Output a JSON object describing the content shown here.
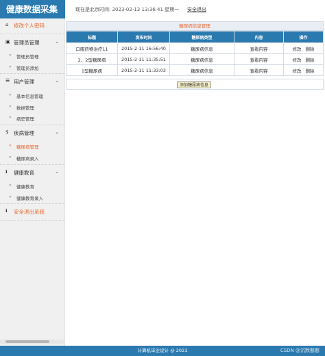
{
  "app": {
    "title": "健康数据采集"
  },
  "header": {
    "status_text": "现在是北京时间: 2023-02-13 13:36:41 星期一",
    "logout_label": "安全退出"
  },
  "sidebar": {
    "change_password": "修改个人密码",
    "admin_group": "管理员管理",
    "admin_items": [
      "管理员管理",
      "管理员添加"
    ],
    "user_group": "用户管理",
    "user_items": [
      "基本信息管理",
      "数据管理",
      "病史管理"
    ],
    "disease_group": "疾病管理",
    "disease_items": [
      "糖尿病管理",
      "糖尿病录入"
    ],
    "edu_group": "健康教育",
    "edu_items": [
      "健康教育",
      "健康教育录入"
    ],
    "logout": "安全退出系统"
  },
  "main": {
    "panel_title": "糖尿病信息管理",
    "columns": [
      "标题",
      "发布时间",
      "糖尿病类型",
      "内容",
      "操作"
    ],
    "rows": [
      {
        "title": "口服药物治疗11",
        "time": "2015-2-11 16:56:40",
        "type": "糖尿病信息",
        "content": "查看内容",
        "edit": "修改",
        "delete": "删除"
      },
      {
        "title": "2、2型糖尿病",
        "time": "2015-2-11 11:35:51",
        "type": "糖尿病信息",
        "content": "查看内容",
        "edit": "修改",
        "delete": "删除"
      },
      {
        "title": "1型糖尿病",
        "time": "2015-2-11 11:33:03",
        "type": "糖尿病信息",
        "content": "查看内容",
        "edit": "修改",
        "delete": "删除"
      }
    ],
    "add_button": "添加糖尿病信息"
  },
  "footer": {
    "text": "计算机毕业设计 @ 2023",
    "watermark": "CSDN @沉默憨憨"
  },
  "colors": {
    "primary": "#2a7ab0",
    "accent": "#e8662b",
    "sidebar_bg": "#f0f0f0"
  }
}
